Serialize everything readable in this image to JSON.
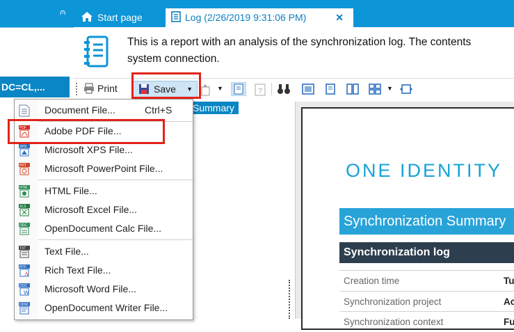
{
  "left_panel": {
    "pin_glyph": "⩀",
    "node_label": "DC=CL,..."
  },
  "tabs": [
    {
      "label": "Start page"
    },
    {
      "label": "Log (2/26/2019 9:31:06 PM)",
      "close": "✕"
    }
  ],
  "header": {
    "description_line1": "This is a report with an analysis of the synchronization log. The contents",
    "description_line2": "system connection."
  },
  "toolbar": {
    "print_label": "Print",
    "save_label": "Save"
  },
  "summary_chip": "Summary",
  "menu": {
    "items": [
      {
        "label": "Document File...",
        "shortcut": "Ctrl+S",
        "icon": "document-file-icon",
        "color": "#6a7f99"
      },
      {
        "label": "Adobe PDF File...",
        "icon": "pdf-file-icon",
        "color": "#d9261c"
      },
      {
        "label": "Microsoft XPS File...",
        "icon": "xps-file-icon",
        "color": "#2f6fc1"
      },
      {
        "label": "Microsoft PowerPoint File...",
        "icon": "ppt-file-icon",
        "color": "#d04727"
      },
      {
        "label": "HTML File...",
        "icon": "html-file-icon",
        "color": "#2e8b57"
      },
      {
        "label": "Microsoft Excel File...",
        "icon": "excel-file-icon",
        "color": "#1f7a3e"
      },
      {
        "label": "OpenDocument Calc File...",
        "icon": "ods-file-icon",
        "color": "#2e8b57"
      },
      {
        "label": "Text File...",
        "icon": "text-file-icon",
        "color": "#444444"
      },
      {
        "label": "Rich Text File...",
        "icon": "rtf-file-icon",
        "color": "#2f6fc1"
      },
      {
        "label": "Microsoft Word File...",
        "icon": "word-file-icon",
        "color": "#2f6fc1"
      },
      {
        "label": "OpenDocument Writer File...",
        "icon": "odt-file-icon",
        "color": "#2f6fc1"
      }
    ],
    "badges": [
      "PDF",
      "XPS",
      "PPT",
      "HTM",
      "XLS",
      "ODC",
      "TXT",
      "RTF",
      "DOC",
      "ODW"
    ]
  },
  "preview": {
    "logo_text": "ONE IDENTITY",
    "summary_title": "Synchronization Summary",
    "log_header": "Synchronization log",
    "rows": [
      {
        "label": "Creation time",
        "value": "Tue"
      },
      {
        "label": "Synchronization project",
        "value": "Acti"
      },
      {
        "label": "Synchronization context",
        "value": "Full"
      }
    ]
  },
  "colors": {
    "accent": "#0c95d7",
    "highlight": "#e2231a",
    "logo": "#15a3d7",
    "dark_header": "#2d3e4e"
  }
}
